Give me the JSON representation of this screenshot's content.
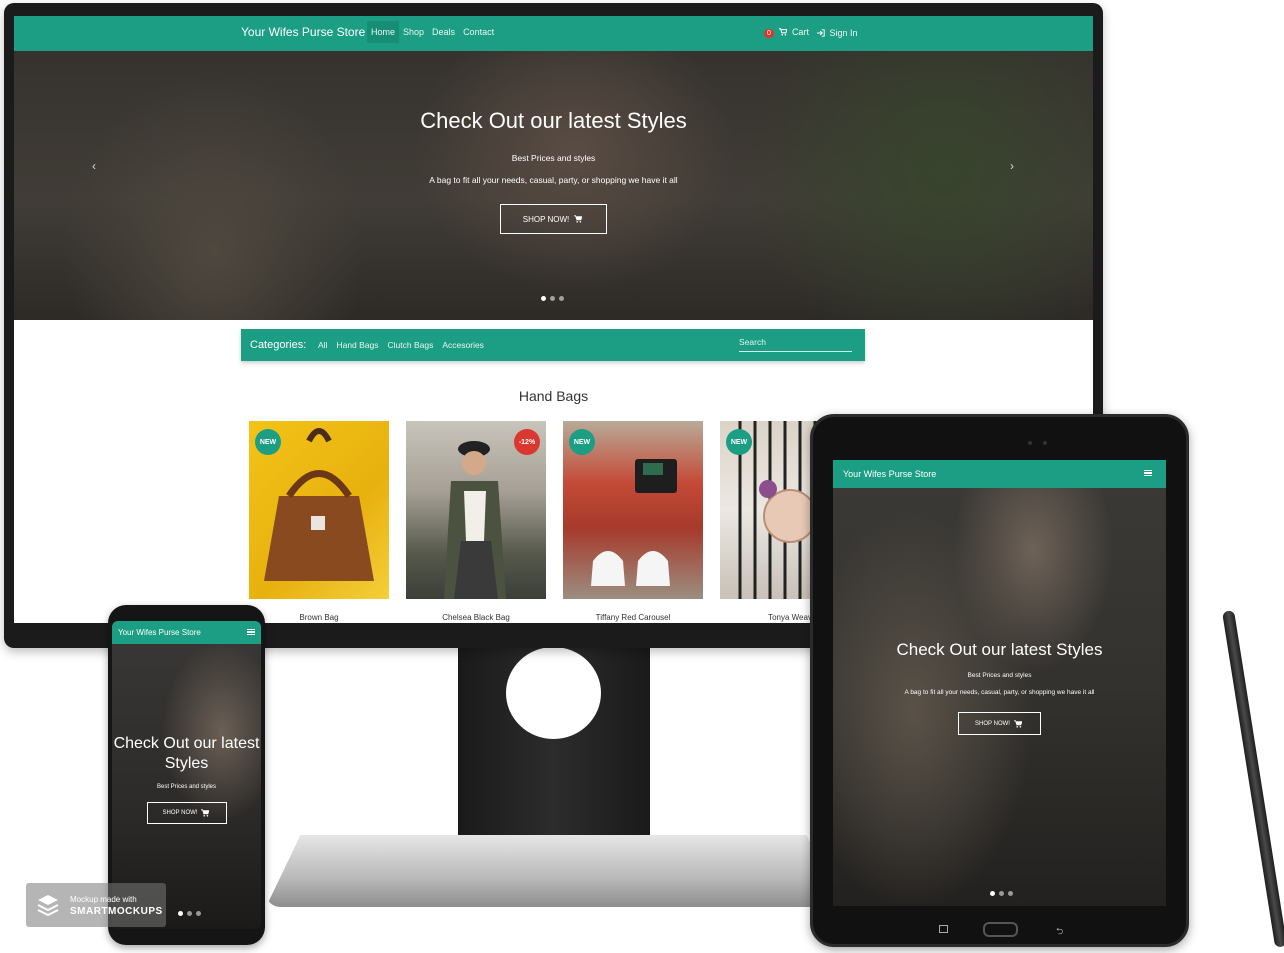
{
  "colors": {
    "brand": "#1b9e83",
    "badge_new": "#1b9e83",
    "badge_sale": "#d9372f",
    "cart_badge": "#d9372f"
  },
  "desktop": {
    "nav": {
      "brand": "Your Wifes Purse Store",
      "links": [
        {
          "label": "Home",
          "active": true
        },
        {
          "label": "Shop"
        },
        {
          "label": "Deals"
        },
        {
          "label": "Contact"
        }
      ],
      "cart_count": "0",
      "cart_label": "Cart",
      "signin_label": "Sign In"
    },
    "hero": {
      "title": "Check Out our latest Styles",
      "subtitle": "Best Prices and styles",
      "description": "A bag to fit all your needs, casual, party, or shopping we have it all",
      "button_label": "SHOP NOW!",
      "prev_arrow": "‹",
      "next_arrow": "›"
    },
    "categories": {
      "label": "Categories:",
      "items": [
        "All",
        "Hand Bags",
        "Clutch Bags",
        "Accesories"
      ],
      "search_placeholder": "Search"
    },
    "section_title": "Hand Bags",
    "products": [
      {
        "name": "Brown Bag",
        "badge": "NEW",
        "badge_type": "new"
      },
      {
        "name": "Chelsea Black Bag",
        "badge": "-12%",
        "badge_type": "sale"
      },
      {
        "name": "Tiffany Red Carousel",
        "badge": "NEW",
        "badge_type": "new"
      },
      {
        "name": "Tonya Weav",
        "badge": "NEW",
        "badge_type": "new"
      }
    ]
  },
  "phone": {
    "brand": "Your Wifes Purse Store",
    "hero_title": "Check Out our latest Styles",
    "subtitle": "Best Prices and styles",
    "button_label": "SHOP NOW!"
  },
  "tablet": {
    "brand": "Your Wifes Purse Store",
    "hero_title": "Check Out our latest Styles",
    "subtitle": "Best Prices and styles",
    "description": "A bag to fit all your needs, casual, party, or shopping we have it all",
    "button_label": "SHOP NOW!"
  },
  "watermark": {
    "line1": "Mockup made with",
    "line2": "SMARTMOCKUPS"
  },
  "icons": {
    "cart": "cart-icon",
    "signin": "sign-in-icon",
    "menu": "hamburger-menu-icon",
    "logo": "layers-icon"
  }
}
